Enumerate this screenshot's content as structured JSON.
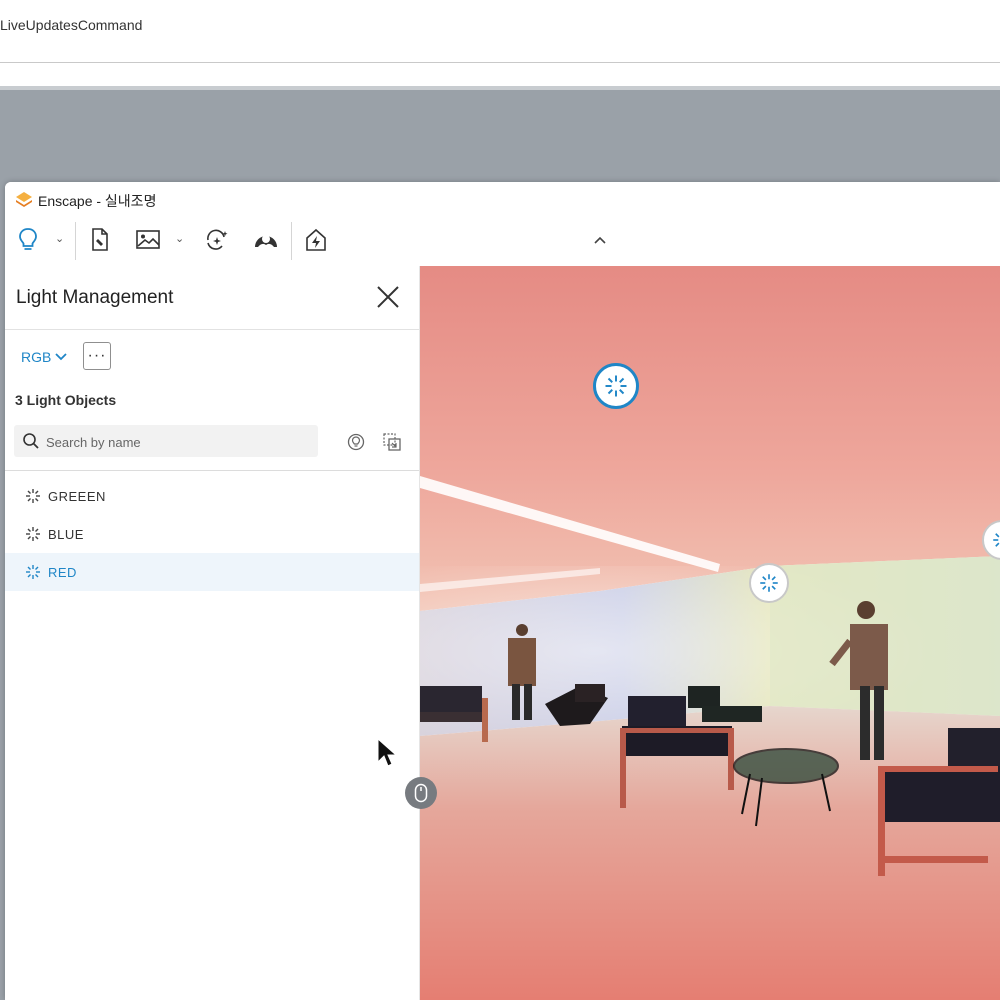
{
  "command_bar": {
    "text": "LiveUpdatesCommand"
  },
  "window": {
    "title": "Enscape - 실내조명"
  },
  "toolbar": {
    "items": [
      {
        "icon": "lightbulb-icon"
      },
      {
        "icon": "document-edit-icon"
      },
      {
        "icon": "image-icon"
      },
      {
        "icon": "sparkle-icon"
      },
      {
        "icon": "sky-icon"
      },
      {
        "icon": "house-bolt-icon"
      }
    ],
    "collapse_icon": "chevron-up-icon"
  },
  "panel": {
    "title": "Light Management",
    "color_mode": "RGB",
    "more_label": "···",
    "count_text": "3 Light Objects",
    "search_placeholder": "Search by name",
    "lights": [
      {
        "name": "GREEEN",
        "selected": false
      },
      {
        "name": "BLUE",
        "selected": false
      },
      {
        "name": "RED",
        "selected": true
      }
    ]
  },
  "colors": {
    "accent": "#1f86c7",
    "selected_row": "#eef5fb",
    "logo": "#f0a030"
  }
}
